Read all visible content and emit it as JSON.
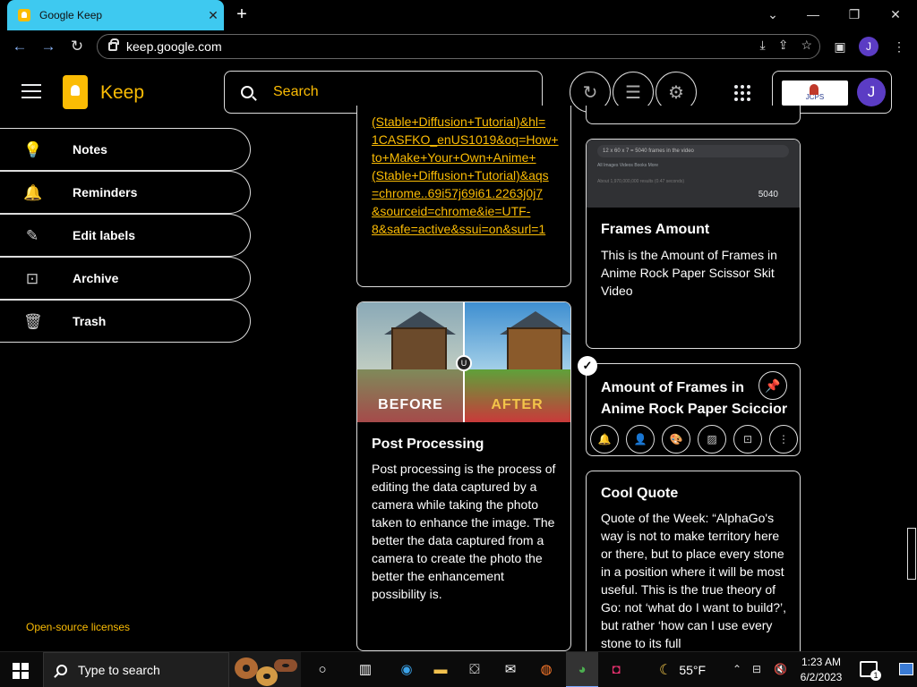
{
  "browser": {
    "tab_title": "Google Keep",
    "tab_close": "✕",
    "new_tab": "+",
    "url": "keep.google.com",
    "profile_initial": "J"
  },
  "header": {
    "app_name": "Keep",
    "search_placeholder": "Search",
    "org_logo_text": "JCPS",
    "avatar_initial": "J"
  },
  "sidebar": {
    "items": [
      {
        "label": "Notes",
        "icon": "lightbulb-icon"
      },
      {
        "label": "Reminders",
        "icon": "bell-icon"
      },
      {
        "label": "Edit labels",
        "icon": "pencil-icon"
      },
      {
        "label": "Archive",
        "icon": "archive-icon"
      },
      {
        "label": "Trash",
        "icon": "trash-icon"
      }
    ],
    "licenses": "Open-source licenses"
  },
  "notes": {
    "link_note": {
      "lines": [
        "(Stable+Diffusion+Tutorial)&hl=",
        "1CASFKO_enUS1019&oq=How+",
        "to+Make+Your+Own+Anime+",
        "(Stable+Diffusion+Tutorial)&aqs",
        "=chrome..69i57j69i61.2263j0j7",
        "&sourceid=chrome&ie=UTF-",
        "8&safe=active&ssui=on&surl=1"
      ]
    },
    "post_processing": {
      "image_before": "BEFORE",
      "image_after": "AFTER",
      "title": "Post Processing",
      "body": "Post processing is the process of editing the data captured by a camera while taking the photo taken to enhance the image. The better the data captured from a camera to create the photo the better the enhancement possibility is."
    },
    "frames_amount": {
      "shot_query": "12 x 60 x 7 = 5040 frames in the video",
      "shot_tabs": "All   Images   Videos   Books   More",
      "shot_line": "About 1,970,000,000 results (0.47 seconds)",
      "shot_result": "5040",
      "title": "Frames Amount",
      "body": "This is the Amount of Frames in Anime Rock Paper Scissor Skit Video"
    },
    "selected": {
      "title_line1": "Amount of Frames in",
      "title_line2": "Anime Rock Paper Scicci",
      "title_tail": "or",
      "check": "✓"
    },
    "cool_quote": {
      "title": "Cool Quote",
      "body": "Quote of the Week: “AlphaGo's way is not to make territory here or there, but to place every stone in a position where it will be most useful. This is the true theory of Go: not ‘what do I want to build?’, but rather ‘how can I use every stone to its full"
    }
  },
  "taskbar": {
    "search_text": "Type to search",
    "temperature": "55°F",
    "time": "1:23 AM",
    "date": "6/2/2023",
    "notification_count": "1"
  },
  "colors": {
    "accent": "#fbbc04",
    "tab": "#3ec9f0",
    "avatar": "#5b3cc4"
  }
}
